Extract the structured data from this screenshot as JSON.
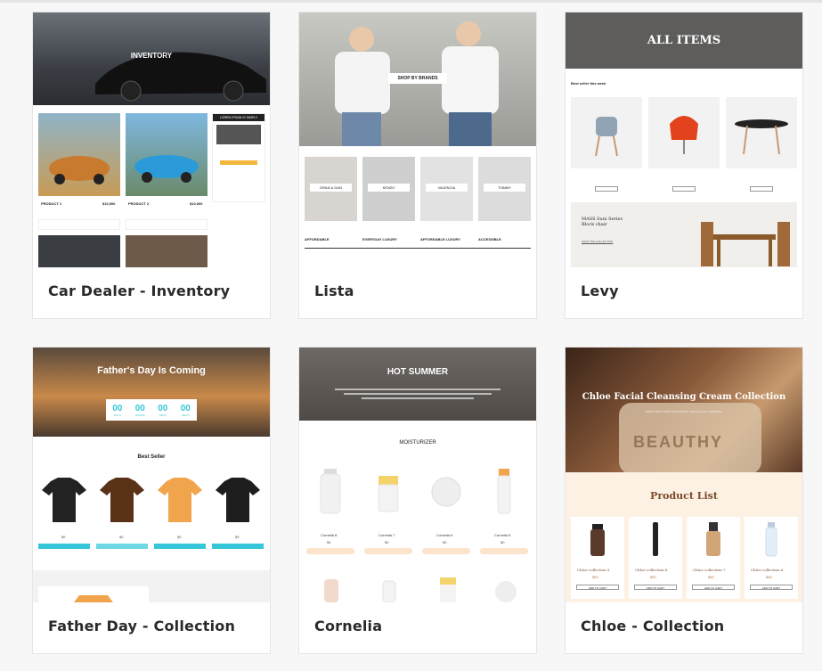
{
  "templates": [
    {
      "name": "Car Dealer - Inventory",
      "banner": "INVENTORY",
      "products": [
        "PRODUCT 1",
        "PRODUCT 2"
      ],
      "prices": [
        "$10,000",
        "$10,000"
      ],
      "sidebar_title": "LOREM IPSUM IS SIMPLY"
    },
    {
      "name": "Lista",
      "banner": "SHOP BY BRANDS",
      "brands": [
        "DRAN & DAN",
        "KENZO",
        "VALENCIA",
        "TOMMY"
      ],
      "columns": [
        "AFFORDABLE",
        "EVERYDAY LUXURY",
        "AFFORDABLE LUXURY",
        "ACCESSIBLE"
      ]
    },
    {
      "name": "Levy",
      "banner": "ALL ITEMS",
      "subheading": "Best seller this week",
      "promo": "MASS Suni Series Block chair",
      "promo_link": "SHOP THE COLLECTION"
    },
    {
      "name": "Father Day - Collection",
      "banner": "Father's Day Is Coming",
      "countdown": [
        {
          "num": "00",
          "label": "DAYS"
        },
        {
          "num": "00",
          "label": "HOURS"
        },
        {
          "num": "00",
          "label": "MINS"
        },
        {
          "num": "00",
          "label": "SECS"
        }
      ],
      "section": "Best Seller",
      "prices": [
        "$9",
        "$9",
        "$9",
        "$9"
      ]
    },
    {
      "name": "Cornelia",
      "banner": "HOT SUMMER",
      "section": "MOISTURIZER",
      "products": [
        "Cornelia 8",
        "Cornelia 7",
        "Cornelia 6",
        "Cornelia 5"
      ],
      "prices": [
        "$0",
        "$0",
        "$0",
        "$0"
      ]
    },
    {
      "name": "Chloe - Collection",
      "banner": "Chloe Facial Cleansing Cream Collection",
      "subtitle": "Insert here brief description about your collection",
      "section": "Product List",
      "products": [
        "Chloe collection 9",
        "Chloe collection 8",
        "Chloe collection 7",
        "Chloe collection 6"
      ],
      "prices": [
        "$50",
        "$50",
        "$50",
        "$50"
      ],
      "button": "ADD TO CART",
      "jar_text": "BEAUTHY"
    }
  ],
  "colors": {
    "accent_cyan": "#35c7d9",
    "accent_orange": "#f0a44b",
    "card_border": "#e6e6e6",
    "cream": "#fdf1e4"
  }
}
